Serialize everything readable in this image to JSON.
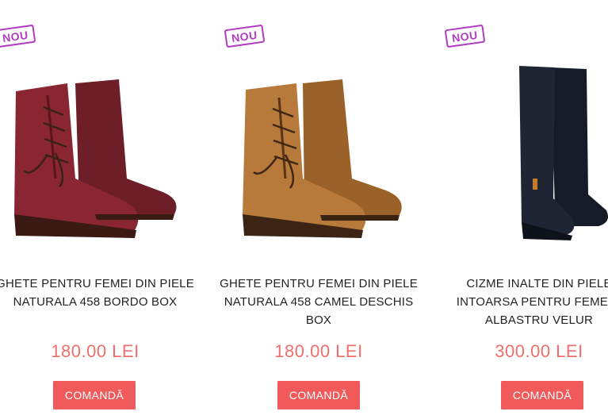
{
  "products": [
    {
      "badge": "NOU",
      "title_lines": [
        "GHETE PENTRU FEMEI DIN PIELE",
        "NATURALA 458 BORDO BOX"
      ],
      "price": "180.00 LEI",
      "button": "COMANDĂ",
      "color": "#8a2632",
      "type": "ankle-boot"
    },
    {
      "badge": "NOU",
      "title_lines": [
        "GHETE PENTRU FEMEI DIN PIELE",
        "NATURALA 458 CAMEL DESCHIS",
        "BOX"
      ],
      "price": "180.00 LEI",
      "button": "COMANDĂ",
      "color": "#b77a3a",
      "type": "ankle-boot"
    },
    {
      "badge": "NOU",
      "title_lines": [
        "CIZME INALTE DIN PIELE",
        "INTOARSA PENTRU FEMEI –",
        "ALBASTRU VELUR"
      ],
      "price": "300.00 LEI",
      "button": "COMANDĂ",
      "color": "#1f2633",
      "type": "tall-boot"
    }
  ]
}
